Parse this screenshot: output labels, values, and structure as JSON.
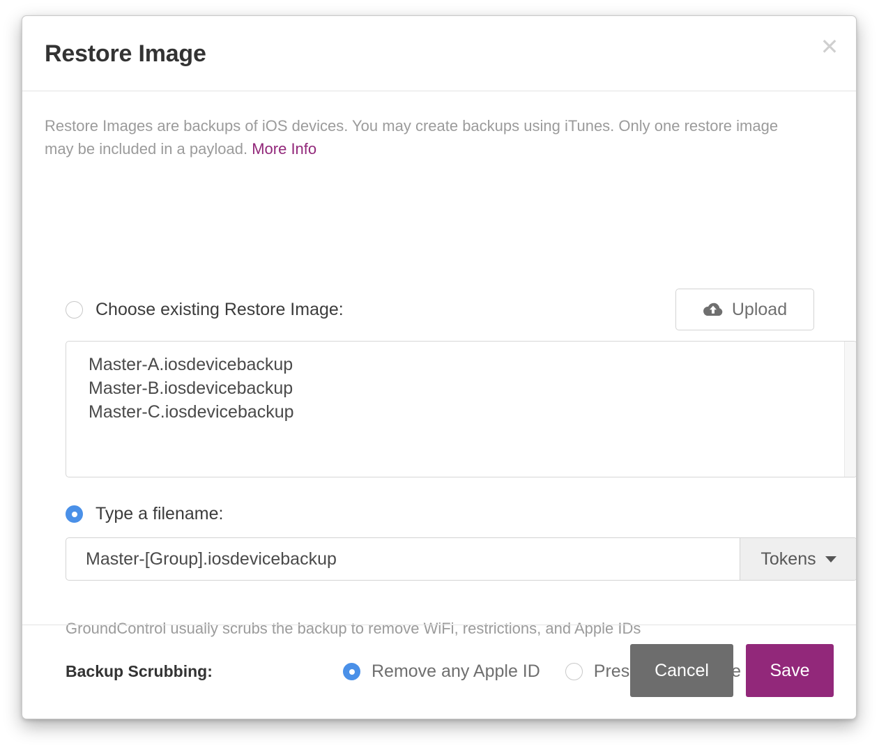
{
  "dialog": {
    "title": "Restore Image",
    "close_icon": "close-icon",
    "intro_text": "Restore Images are backups of iOS devices. You may create backups using iTunes. Only one restore image may be included in a payload. ",
    "more_info_link": "More Info"
  },
  "existing": {
    "radio_label": "Choose existing Restore Image:",
    "selected": false,
    "upload_button": "Upload",
    "upload_icon": "cloud-upload-icon",
    "files": [
      "Master-A.iosdevicebackup",
      "Master-B.iosdevicebackup",
      "Master-C.iosdevicebackup"
    ]
  },
  "filename": {
    "radio_label": "Type a filename:",
    "selected": true,
    "value": "Master-[Group].iosdevicebackup",
    "placeholder": "Master-[Group].iosdevicebackup",
    "tokens_button": "Tokens",
    "tokens_icon": "chevron-down-icon"
  },
  "scrubbing": {
    "note": "GroundControl usually scrubs the backup to remove WiFi, restrictions, and Apple IDs",
    "label": "Backup Scrubbing:",
    "options": [
      {
        "label": "Remove any Apple ID",
        "selected": true
      },
      {
        "label": "Preserve the Apple ID",
        "selected": false
      }
    ]
  },
  "footer": {
    "cancel_label": "Cancel",
    "save_label": "Save"
  },
  "colors": {
    "accent": "#92287a",
    "radio_selected": "#4a90e8",
    "cancel": "#6d6d6d",
    "muted_text": "#9b9b9b"
  }
}
